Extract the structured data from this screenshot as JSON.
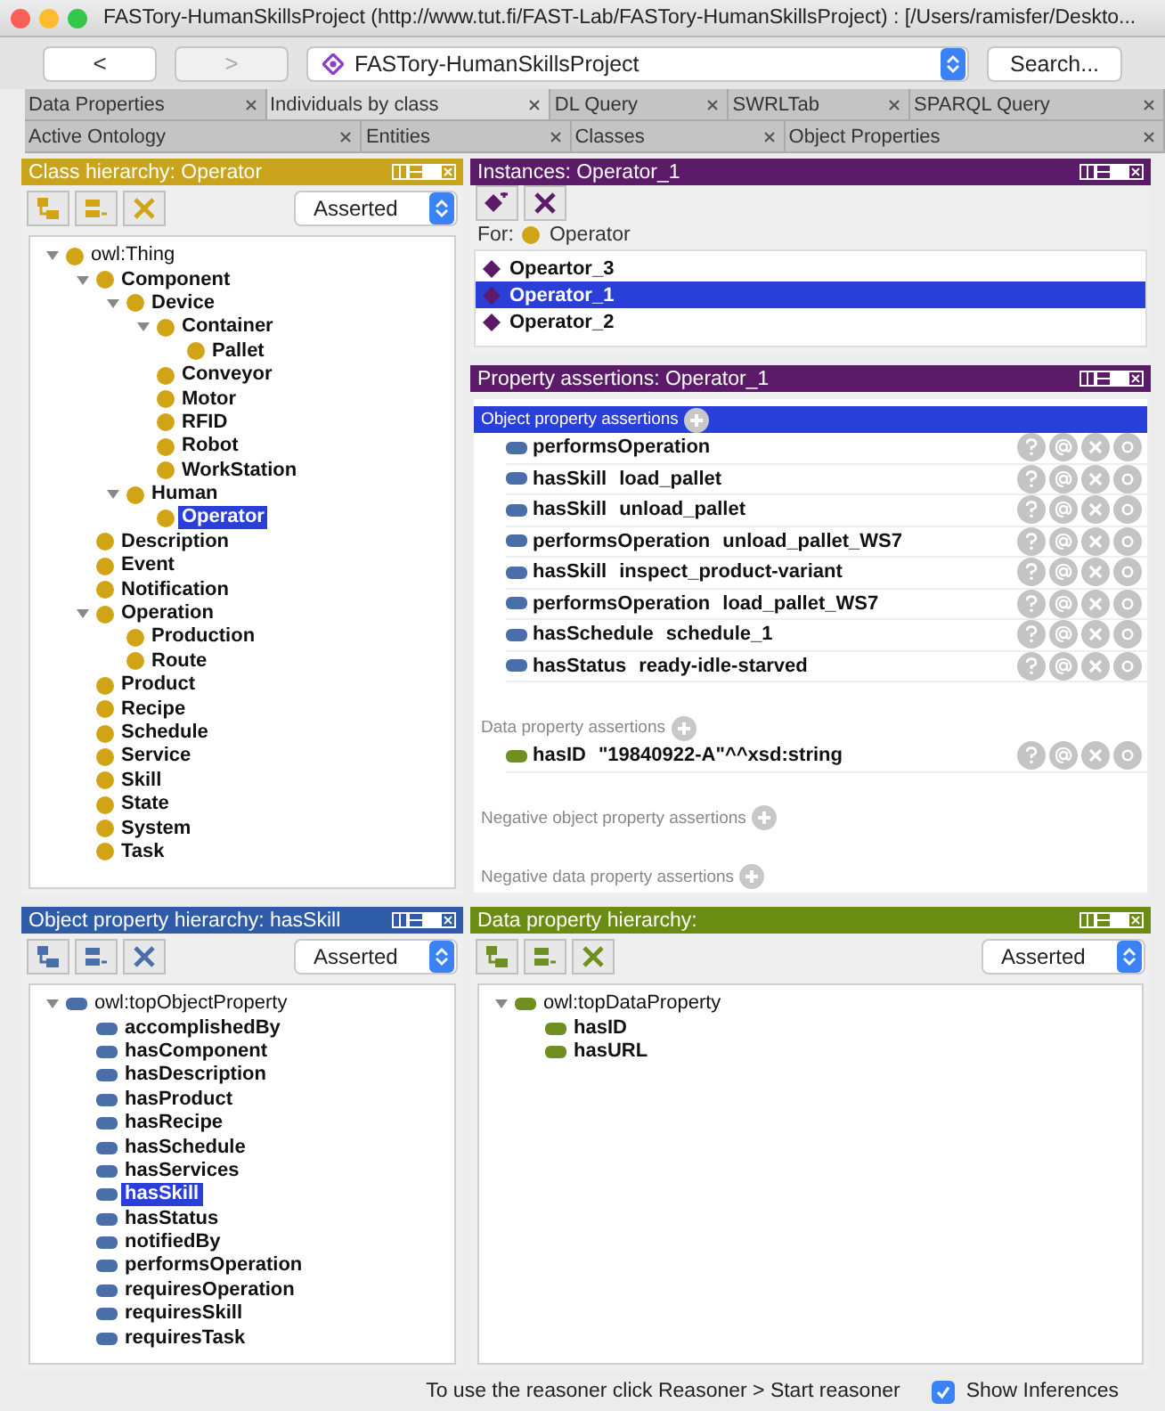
{
  "window": {
    "title": "FASTory-HumanSkillsProject (http://www.tut.fi/FAST-Lab/FASTory-HumanSkillsProject) : [/Users/ramisfer/Deskto..."
  },
  "toolbar": {
    "back": {
      "label": "<",
      "disabled": false
    },
    "forward": {
      "label": ">",
      "disabled": true
    },
    "ontology": "FASTory-HumanSkillsProject",
    "search": "Search..."
  },
  "tab_rows": [
    [
      {
        "label": "Data Properties",
        "selected": false
      },
      {
        "label": "Individuals by class",
        "selected": true
      },
      {
        "label": "DL Query",
        "selected": false
      },
      {
        "label": "SWRLTab",
        "selected": false
      },
      {
        "label": "SPARQL Query",
        "selected": false
      }
    ],
    [
      {
        "label": "Active Ontology",
        "selected": false
      },
      {
        "label": "Entities",
        "selected": false
      },
      {
        "label": "Classes",
        "selected": false
      },
      {
        "label": "Object Properties",
        "selected": false
      }
    ]
  ],
  "class_hierarchy": {
    "kind": "class",
    "title": "Class hierarchy: Operator",
    "mode": "Asserted",
    "tree": [
      {
        "label": "owl:Thing",
        "selected": false,
        "expanded": true,
        "children": [
          {
            "label": "Component",
            "selected": false,
            "expanded": true,
            "children": [
              {
                "label": "Device",
                "selected": false,
                "expanded": true,
                "children": [
                  {
                    "label": "Container",
                    "selected": false,
                    "expanded": true,
                    "children": [
                      {
                        "label": "Pallet",
                        "selected": false
                      }
                    ]
                  },
                  {
                    "label": "Conveyor",
                    "selected": false
                  },
                  {
                    "label": "Motor",
                    "selected": false
                  },
                  {
                    "label": "RFID",
                    "selected": false
                  },
                  {
                    "label": "Robot",
                    "selected": false
                  },
                  {
                    "label": "WorkStation",
                    "selected": false
                  }
                ]
              },
              {
                "label": "Human",
                "selected": false,
                "expanded": true,
                "children": [
                  {
                    "label": "Operator",
                    "selected": true
                  }
                ]
              }
            ]
          },
          {
            "label": "Description",
            "selected": false
          },
          {
            "label": "Event",
            "selected": false
          },
          {
            "label": "Notification",
            "selected": false
          },
          {
            "label": "Operation",
            "selected": false,
            "expanded": true,
            "children": [
              {
                "label": "Production",
                "selected": false
              },
              {
                "label": "Route",
                "selected": false
              }
            ]
          },
          {
            "label": "Product",
            "selected": false
          },
          {
            "label": "Recipe",
            "selected": false
          },
          {
            "label": "Schedule",
            "selected": false
          },
          {
            "label": "Service",
            "selected": false
          },
          {
            "label": "Skill",
            "selected": false
          },
          {
            "label": "State",
            "selected": false
          },
          {
            "label": "System",
            "selected": false
          },
          {
            "label": "Task",
            "selected": false
          }
        ]
      }
    ]
  },
  "instances": {
    "kind": "individual",
    "title": "Instances: Operator_1",
    "for_label": "For:",
    "for_class": "Operator",
    "items": [
      {
        "name": "Opeartor_3",
        "selected": false
      },
      {
        "name": "Operator_1",
        "selected": true
      },
      {
        "name": "Operator_2",
        "selected": false
      }
    ]
  },
  "property_assertions": {
    "kind": "individual",
    "title": "Property assertions: Operator_1",
    "sections": [
      {
        "label": "Object property assertions",
        "kind": "object",
        "selected": true,
        "items": [
          {
            "property": "performsOperation"
          },
          {
            "property": "hasSkill",
            "value": "load_pallet"
          },
          {
            "property": "hasSkill",
            "value": "unload_pallet"
          },
          {
            "property": "performsOperation",
            "value": "unload_pallet_WS7"
          },
          {
            "property": "hasSkill",
            "value": "inspect_product-variant"
          },
          {
            "property": "performsOperation",
            "value": "load_pallet_WS7"
          },
          {
            "property": "hasSchedule",
            "value": "schedule_1"
          },
          {
            "property": "hasStatus",
            "value": "ready-idle-starved"
          }
        ]
      },
      {
        "label": "Data property assertions",
        "kind": "data",
        "selected": false,
        "items": [
          {
            "property": "hasID",
            "value": "\"19840922-A\"^^xsd:string"
          }
        ]
      },
      {
        "label": "Negative object property assertions",
        "selected": false
      },
      {
        "label": "Negative data property assertions",
        "selected": false
      }
    ]
  },
  "object_property_hierarchy": {
    "kind": "object",
    "title": "Object property hierarchy: hasSkill",
    "mode": "Asserted",
    "tree": [
      {
        "label": "owl:topObjectProperty",
        "selected": false,
        "expanded": true,
        "children": [
          {
            "label": "accomplishedBy",
            "selected": false
          },
          {
            "label": "hasComponent",
            "selected": false
          },
          {
            "label": "hasDescription",
            "selected": false
          },
          {
            "label": "hasProduct",
            "selected": false
          },
          {
            "label": "hasRecipe",
            "selected": false
          },
          {
            "label": "hasSchedule",
            "selected": false
          },
          {
            "label": "hasServices",
            "selected": false
          },
          {
            "label": "hasSkill",
            "selected": true
          },
          {
            "label": "hasStatus",
            "selected": false
          },
          {
            "label": "notifiedBy",
            "selected": false
          },
          {
            "label": "performsOperation",
            "selected": false
          },
          {
            "label": "requiresOperation",
            "selected": false
          },
          {
            "label": "requiresSkill",
            "selected": false
          },
          {
            "label": "requiresTask",
            "selected": false
          }
        ]
      }
    ]
  },
  "data_property_hierarchy": {
    "kind": "data",
    "title": "Data property hierarchy:",
    "mode": "Asserted",
    "tree": [
      {
        "label": "owl:topDataProperty",
        "selected": false,
        "expanded": true,
        "children": [
          {
            "label": "hasID",
            "selected": false
          },
          {
            "label": "hasURL",
            "selected": false
          }
        ]
      }
    ]
  },
  "status_bar": {
    "message": "To use the reasoner click Reasoner > Start reasoner",
    "show_inferences": {
      "label": "Show Inferences",
      "checked": true
    }
  }
}
